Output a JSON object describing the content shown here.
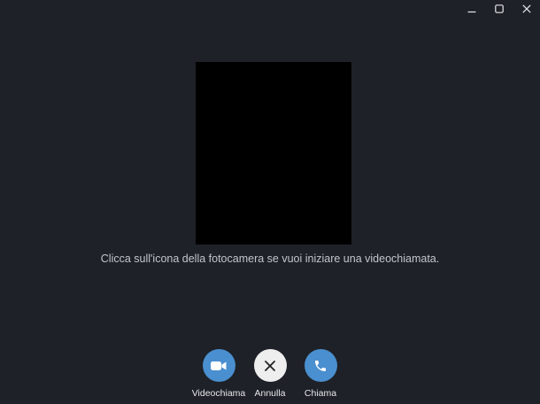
{
  "window": {
    "controls": [
      {
        "name": "minimize",
        "icon": "minimize-icon"
      },
      {
        "name": "maximize",
        "icon": "maximize-icon"
      },
      {
        "name": "close",
        "icon": "close-icon"
      }
    ]
  },
  "main": {
    "hint_text": "Clicca sull'icona della fotocamera se vuoi iniziare una videochiamata."
  },
  "actions": {
    "video": {
      "label": "Videochiama",
      "icon": "video-camera-icon",
      "color": "#4a8fcf"
    },
    "cancel": {
      "label": "Annulla",
      "icon": "close-icon",
      "color": "#eeeeee"
    },
    "call": {
      "label": "Chiama",
      "icon": "phone-icon",
      "color": "#4a8fcf"
    }
  },
  "colors": {
    "background": "#1e2127",
    "preview": "#000000",
    "accent": "#4a8fcf"
  }
}
